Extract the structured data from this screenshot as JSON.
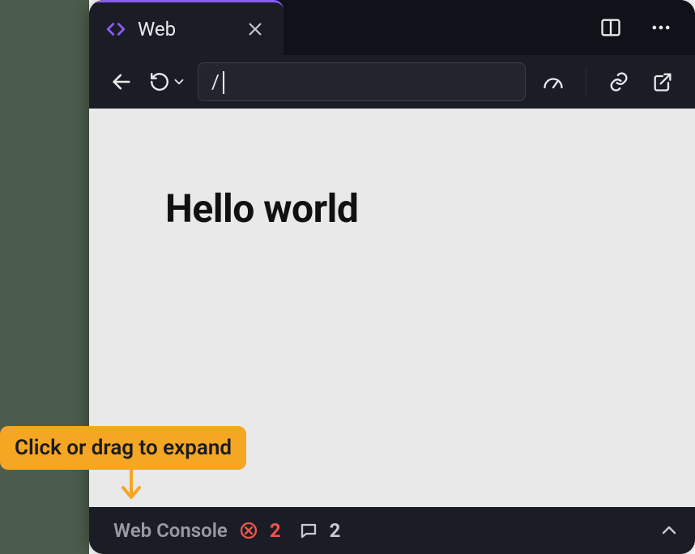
{
  "tab": {
    "title": "Web"
  },
  "addressBar": {
    "value": "/"
  },
  "page": {
    "heading": "Hello world"
  },
  "console": {
    "label": "Web Console",
    "errorCount": "2",
    "messageCount": "2"
  },
  "callout": {
    "text": "Click or drag to expand"
  }
}
